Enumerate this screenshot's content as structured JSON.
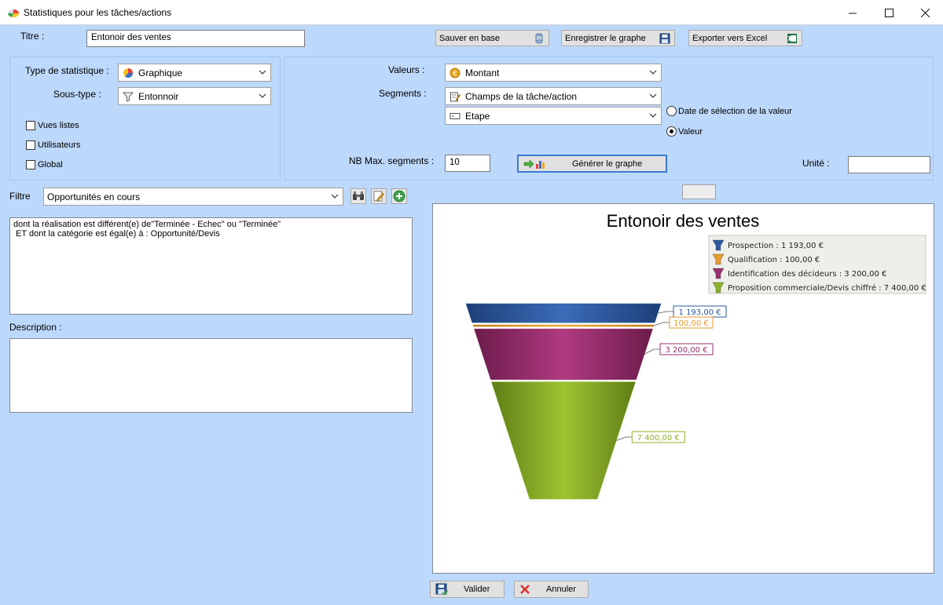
{
  "window": {
    "title": "Statistiques pour les tâches/actions"
  },
  "titre": {
    "label": "Titre  :",
    "value": "Entonoir des ventes"
  },
  "toolbar": {
    "save_db": "Sauver en base",
    "save_graph": "Enregistrer le graphe",
    "export_excel": "Exporter vers Excel"
  },
  "left_panel": {
    "type_label": "Type de statistique  :",
    "type_value": "Graphique",
    "subtype_label": "Sous-type  :",
    "subtype_value": "Entonnoir",
    "checks": [
      {
        "label": "Vues listes",
        "checked": false
      },
      {
        "label": "Utilisateurs",
        "checked": false
      },
      {
        "label": "Global",
        "checked": false
      }
    ]
  },
  "right_panel": {
    "valeurs_label": "Valeurs :",
    "valeurs_value": "Montant",
    "segments_label": "Segments :",
    "segments_value1": "Champs de la tâche/action",
    "segments_value2": "Etape",
    "radio_date": "Date de sélection de la  valeur",
    "radio_valeur": "Valeur",
    "radio_selected": "valeur",
    "nbmax_label": "NB Max. segments :",
    "nbmax_value": "10",
    "generate_button": "Générer le graphe",
    "unite_label": "Unité :",
    "unite_value": ""
  },
  "filter": {
    "label": "Filtre",
    "value": "Opportunités en cours",
    "text_line1": "dont la réalisation est différent(e) de\"Terminée - Echec\" ou \"Terminée\"",
    "text_line2": " ET dont la catégorie est égal(e) à : Opportunité/Devis"
  },
  "description": {
    "label": "Description :",
    "value": ""
  },
  "footer": {
    "ok": "Valider",
    "cancel": "Annuler"
  },
  "chart_data": {
    "type": "funnel",
    "title": "Entonoir des ventes",
    "categories": [
      "Prospection",
      "Qualification",
      "Identification des décideurs",
      "Proposition commerciale/Devis chiffré"
    ],
    "values": [
      1193.0,
      100.0,
      3200.0,
      7400.0
    ],
    "value_labels": [
      "1 193,00 €",
      "100,00 €",
      "3 200,00 €",
      "7 400,00 €"
    ],
    "legend": [
      "Prospection : 1 193,00 €",
      "Qualification :  100,00 €",
      "Identification des décideurs : 3 200,00 €",
      "Proposition commerciale/Devis chiffré : 7 400,00 €"
    ],
    "colors": [
      "#2a5aa0",
      "#e89a2a",
      "#9a2f6e",
      "#8db228"
    ],
    "legend_position": "top-right"
  }
}
